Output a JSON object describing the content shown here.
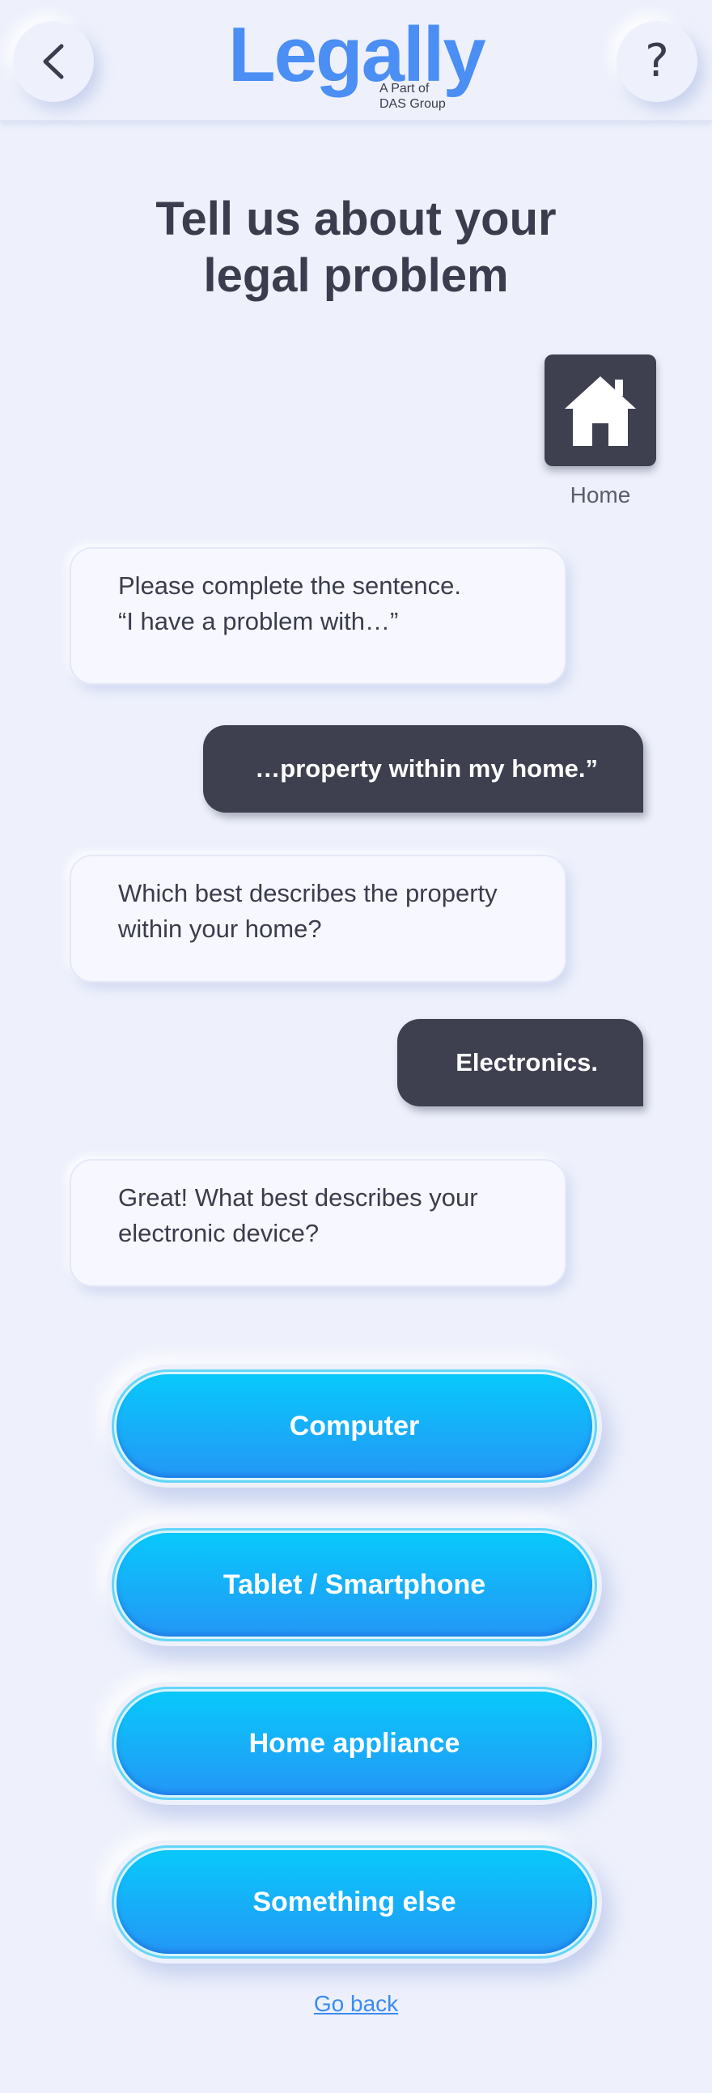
{
  "header": {
    "back_icon": "chevron-left-icon",
    "help_label": "?",
    "logo_word": "Legally",
    "logo_sub_line1": "A Part of",
    "logo_sub_line2": "DAS Group",
    "logo_color": "#4b8ef4"
  },
  "title": {
    "line1": "Tell us about your",
    "line2": "legal problem"
  },
  "category": {
    "icon": "home-icon",
    "label": "Home"
  },
  "conversation": [
    {
      "from": "bot",
      "lines": [
        "Please complete the sentence.",
        "“I have a problem with…”"
      ]
    },
    {
      "from": "user",
      "text": "…property within my home.”"
    },
    {
      "from": "bot",
      "lines": [
        "Which best describes the property",
        "within your home?"
      ]
    },
    {
      "from": "user",
      "text": "Electronics."
    },
    {
      "from": "bot",
      "lines": [
        "Great! What best describes your",
        "electronic device?"
      ]
    }
  ],
  "options": [
    {
      "label": "Computer"
    },
    {
      "label": "Tablet / Smartphone"
    },
    {
      "label": "Home appliance"
    },
    {
      "label": "Something else"
    }
  ],
  "footer": {
    "go_back": "Go back"
  },
  "colors": {
    "background": "#eef1fc",
    "dark": "#3e4050",
    "accent_start": "#08c9fb",
    "accent_end": "#2497f6",
    "link": "#3a8bf3"
  }
}
